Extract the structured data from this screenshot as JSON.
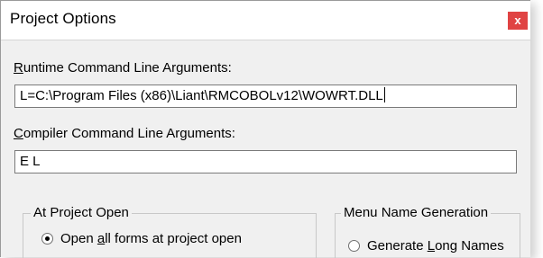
{
  "window": {
    "title": "Project Options",
    "close_glyph": "x"
  },
  "runtime": {
    "label_accel": "R",
    "label_rest": "untime Command Line Arguments:",
    "value": "L=C:\\Program Files (x86)\\Liant\\RMCOBOLv12\\WOWRT.DLL"
  },
  "compiler": {
    "label_accel": "C",
    "label_rest": "ompiler Command Line Arguments:",
    "value": "E L"
  },
  "project_open": {
    "legend": "At Project Open",
    "option_pre": "Open ",
    "option_accel": "a",
    "option_post": "ll forms at project open",
    "checked": true
  },
  "menu_names": {
    "legend": "Menu Name Generation",
    "option_pre": "Generate ",
    "option_accel": "L",
    "option_post": "ong Names",
    "checked": false
  },
  "colors": {
    "close_button": "#e04343",
    "dialog_background": "#f0f0f0"
  }
}
